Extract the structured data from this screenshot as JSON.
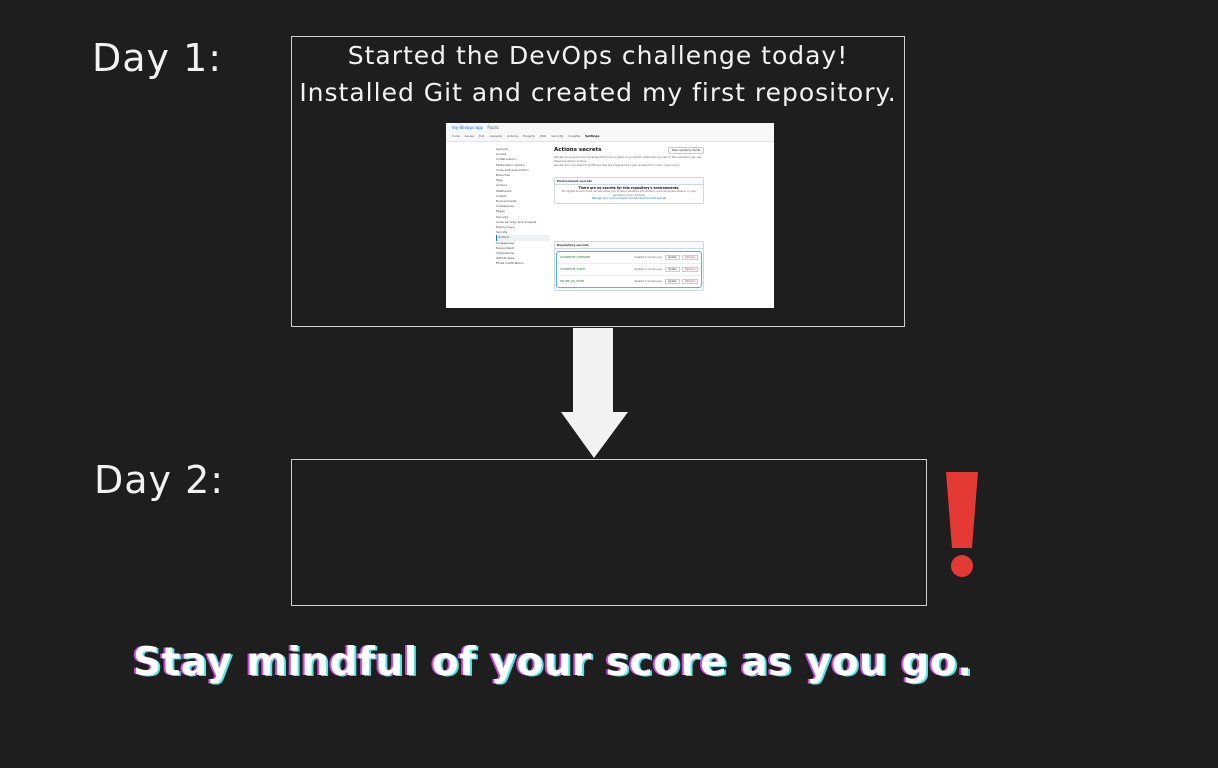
{
  "day1": {
    "label": "Day 1:",
    "text": "Started the DevOps challenge today! Installed Git and created my first repository."
  },
  "day2": {
    "label": "Day 2:",
    "text": ""
  },
  "footer": "Stay mindful of your score as you go.",
  "colors": {
    "background": "#1e1e1e",
    "exclamation": "#e53935",
    "arrow": "#f2f2f2",
    "footer_shadow_left": "#c94bd6",
    "footer_shadow_right": "#4ee6e6"
  },
  "screenshot": {
    "repo": "my-devops-app",
    "visibility": "Public",
    "tabs": [
      "Code",
      "Issues",
      "Pull requests",
      "Actions",
      "Projects",
      "Wiki",
      "Security",
      "Insights",
      "Settings"
    ],
    "sidebar": [
      "General",
      "Access",
      "Collaborators",
      "Moderation options",
      "Code and automation",
      "Branches",
      "Tags",
      "Actions",
      "Webhooks",
      "Copilot",
      "Environments",
      "Codespaces",
      "Pages",
      "Security",
      "Code security and analysis",
      "Deploy keys",
      "Secrets",
      "Actions",
      "Codespaces",
      "Dependabot",
      "Integrations",
      "GitHub apps",
      "Email notifications"
    ],
    "title": "Actions secrets",
    "new_button": "New repository secret",
    "description": "Secrets are environment variables that are encrypted. Anyone with collaborator access to this repository can use these secrets for Actions.",
    "note": "Secrets are not passed to workflows that are triggered by a pull request from a fork. Learn more.",
    "env_header": "Environment secrets",
    "env_empty_title": "There are no secrets for this repository's environments.",
    "env_empty_body": "Encrypted environment secrets allow you to store sensitive information, such as access tokens, in your repository environments.",
    "env_link": "Manage your environments and add environment secrets",
    "repo_header": "Repository secrets",
    "secrets": [
      {
        "name": "DOCKERHUB_USERNAME",
        "updated": "Updated 3 minutes ago"
      },
      {
        "name": "DOCKERHUB_TOKEN",
        "updated": "Updated 3 minutes ago"
      },
      {
        "name": "SECURE_API_TOKEN",
        "updated": "Updated 3 minutes ago"
      }
    ],
    "update_label": "Update",
    "remove_label": "Remove"
  }
}
